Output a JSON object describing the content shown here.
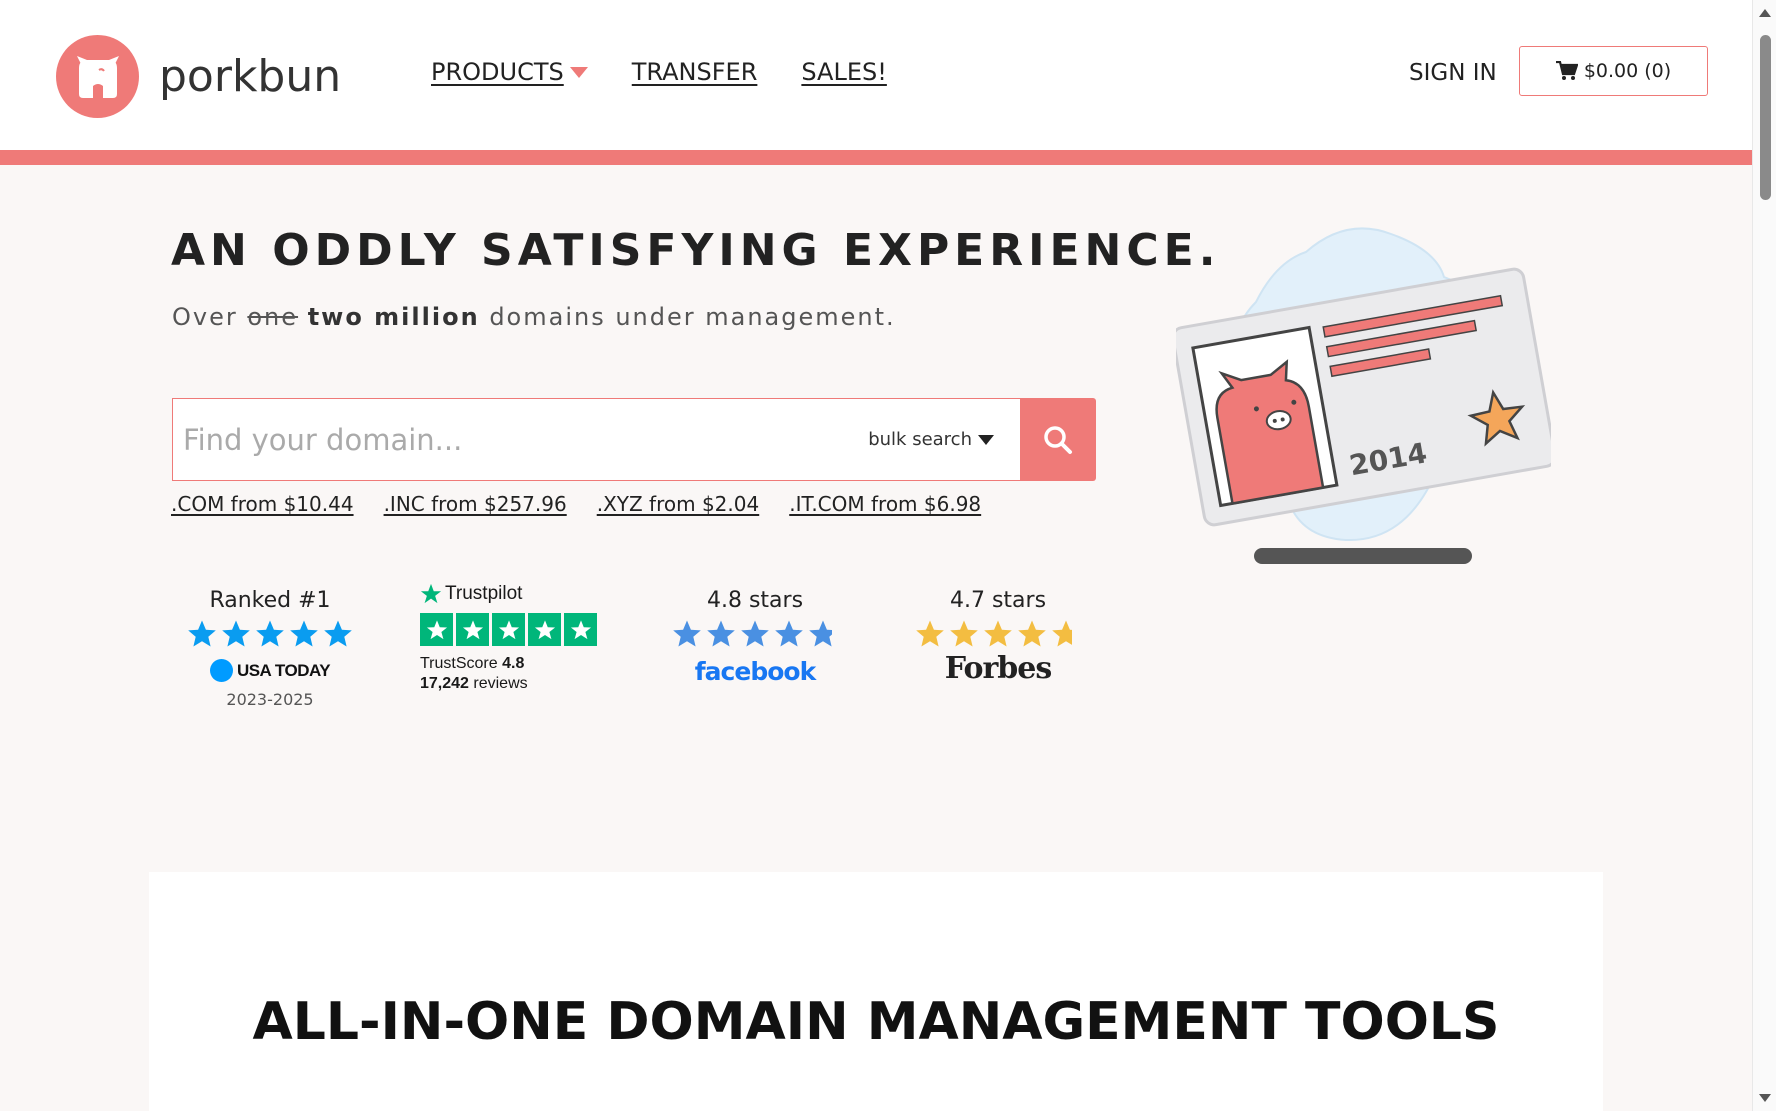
{
  "header": {
    "brand": "porkbun",
    "nav": [
      {
        "label": "PRODUCTS"
      },
      {
        "label": "TRANSFER"
      },
      {
        "label": "SALES!"
      }
    ],
    "sign_in": "SIGN IN",
    "cart_label": "$0.00 (0)"
  },
  "hero": {
    "headline": "AN ODDLY SATISFYING EXPERIENCE.",
    "sub_over": "Over",
    "sub_strike": "one",
    "sub_bold": "two million",
    "sub_rest": "domains under management.",
    "search_placeholder": "Find your domain...",
    "bulk_label": "bulk search",
    "tlds": [
      {
        "label": ".COM from $10.44"
      },
      {
        "label": ".INC from $257.96"
      },
      {
        "label": ".XYZ from $2.04"
      },
      {
        "label": ".IT.COM from $6.98"
      }
    ],
    "card_year": "2014"
  },
  "ratings": {
    "usatoday": {
      "label": "Ranked #1",
      "stars": 5,
      "brand": "USA TODAY",
      "years": "2023-2025"
    },
    "trustpilot": {
      "brand": "Trustpilot",
      "score_label": "TrustScore",
      "score": "4.8",
      "reviews_count": "17,242",
      "reviews_label": "reviews",
      "stars": 5
    },
    "facebook": {
      "label": "4.8 stars",
      "stars": 4.8,
      "brand": "facebook"
    },
    "forbes": {
      "label": "4.7 stars",
      "stars": 4.7,
      "brand": "Forbes"
    }
  },
  "colors": {
    "brand": "#ef7a78",
    "blue_star": "#0a9cf0",
    "fb_star": "#4a90e2",
    "forbes_star": "#f3bd41",
    "trustpilot": "#00b67a"
  },
  "tools": {
    "title": "ALL-IN-ONE DOMAIN MANAGEMENT TOOLS"
  }
}
